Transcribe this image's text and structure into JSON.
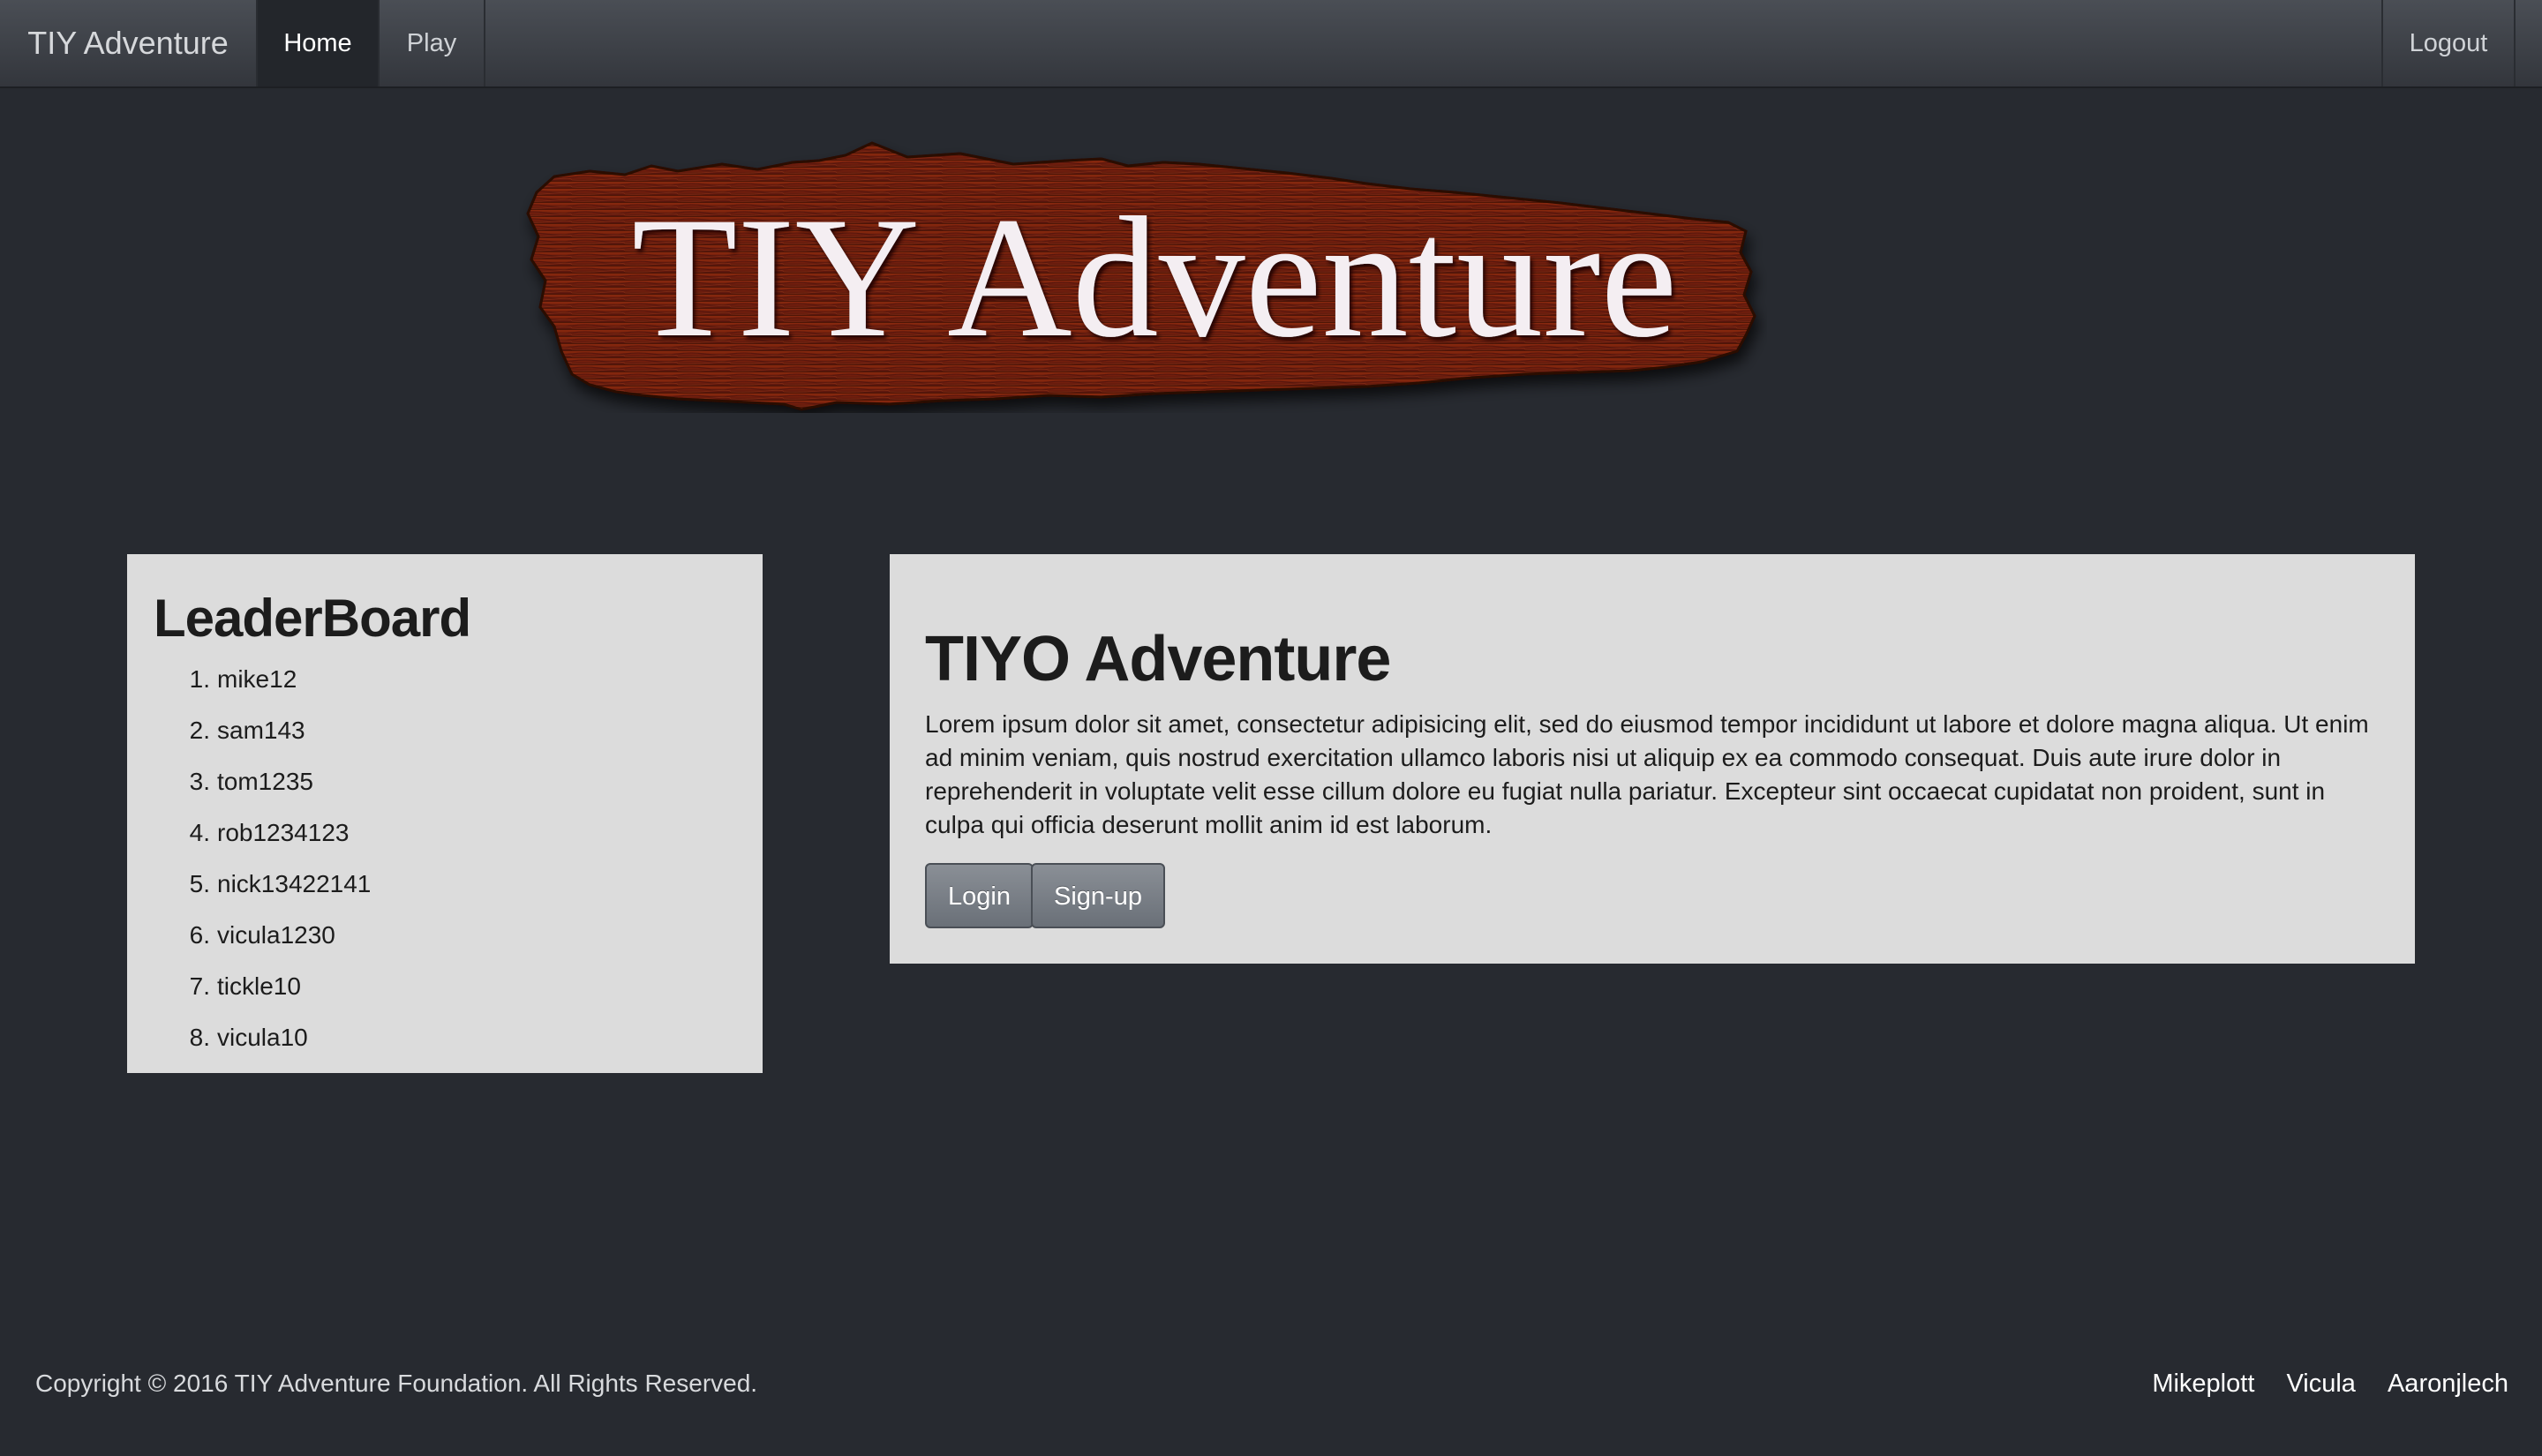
{
  "nav": {
    "brand": "TIY Adventure",
    "items": [
      {
        "label": "Home",
        "active": true
      },
      {
        "label": "Play",
        "active": false
      }
    ],
    "logout": "Logout"
  },
  "logo": {
    "text": "TIY Adventure",
    "colors": {
      "wood": "#7a220e",
      "wood_dark": "#3f0e05",
      "text": "#f4eef2"
    }
  },
  "leaderboard": {
    "title": "LeaderBoard",
    "entries": [
      {
        "rank": "1.",
        "name": "mike12"
      },
      {
        "rank": "2.",
        "name": "sam143"
      },
      {
        "rank": "3.",
        "name": "tom1235"
      },
      {
        "rank": "4.",
        "name": "rob1234123"
      },
      {
        "rank": "5.",
        "name": "nick13422141"
      },
      {
        "rank": "6.",
        "name": "vicula1230"
      },
      {
        "rank": "7.",
        "name": "tickle10"
      },
      {
        "rank": "8.",
        "name": "vicula10"
      }
    ]
  },
  "main": {
    "title": "TIYO Adventure",
    "body": "Lorem ipsum dolor sit amet, consectetur adipisicing elit, sed do eiusmod tempor incididunt ut labore et dolore magna aliqua. Ut enim ad minim veniam, quis nostrud exercitation ullamco laboris nisi ut aliquip ex ea commodo consequat. Duis aute irure dolor in reprehenderit in voluptate velit esse cillum dolore eu fugiat nulla pariatur. Excepteur sint occaecat cupidatat non proident, sunt in culpa qui officia deserunt mollit anim id est laborum.",
    "login_label": "Login",
    "signup_label": "Sign-up"
  },
  "footer": {
    "copyright": "Copyright © 2016 TIY Adventure Foundation. All Rights Reserved.",
    "links": [
      "Mikeplott",
      "Vicula",
      "Aaronjlech"
    ]
  },
  "colors": {
    "background": "#272a30",
    "panel": "#dcdcdc",
    "navbar": "#3e4248"
  }
}
